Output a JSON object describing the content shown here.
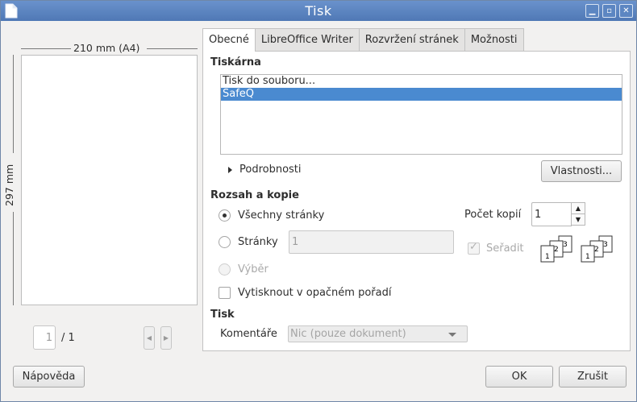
{
  "window": {
    "title": "Tisk"
  },
  "preview": {
    "width_label": "210 mm (A4)",
    "height_label": "297 mm",
    "current_page": "1",
    "total_pages": "/ 1"
  },
  "tabs": [
    {
      "label": "Obecné",
      "active": true
    },
    {
      "label": "LibreOffice Writer",
      "active": false
    },
    {
      "label": "Rozvržení stránek",
      "active": false
    },
    {
      "label": "Možnosti",
      "active": false
    }
  ],
  "printer": {
    "section_title": "Tiskárna",
    "list": [
      {
        "label": "Tisk do souboru...",
        "selected": false
      },
      {
        "label": "SafeQ",
        "selected": true
      }
    ],
    "details_label": "Podrobnosti",
    "properties_button": "Vlastnosti..."
  },
  "range": {
    "section_title": "Rozsah a kopie",
    "all_pages": "Všechny stránky",
    "pages": "Stránky",
    "pages_value": "1",
    "selection": "Výběr",
    "reverse_order": "Vytisknout v opačném pořadí",
    "copies_label": "Počet kopií",
    "copies_value": "1",
    "collate_label": "Seřadit"
  },
  "print": {
    "section_title": "Tisk",
    "comments_label": "Komentáře",
    "comments_value": "Nic (pouze dokument)"
  },
  "buttons": {
    "help": "Nápověda",
    "ok": "OK",
    "cancel": "Zrušit"
  },
  "colors": {
    "titlebar": "#5a84c0",
    "selection": "#4a8ad0"
  }
}
